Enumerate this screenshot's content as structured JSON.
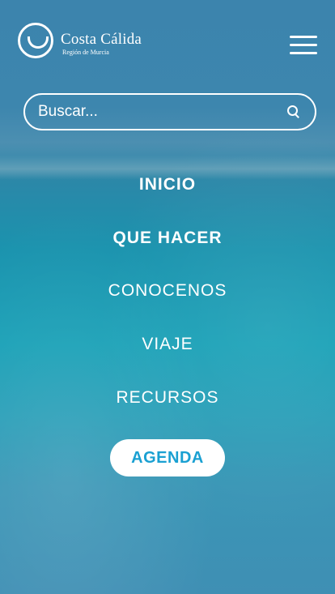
{
  "brand": {
    "title": "Costa Cálida",
    "subtitle": "Región de Murcia"
  },
  "header": {
    "menu_icon": "hamburger-menu-icon"
  },
  "search": {
    "placeholder": "Buscar...",
    "icon": "search-icon"
  },
  "nav": {
    "items": [
      {
        "label": "INICIO"
      },
      {
        "label": "QUE HACER"
      },
      {
        "label": "CONOCENOS"
      },
      {
        "label": "VIAJE"
      },
      {
        "label": "RECURSOS"
      }
    ],
    "cta_label": "AGENDA"
  },
  "colors": {
    "cta_text": "#1aa0d2",
    "text": "#ffffff"
  }
}
